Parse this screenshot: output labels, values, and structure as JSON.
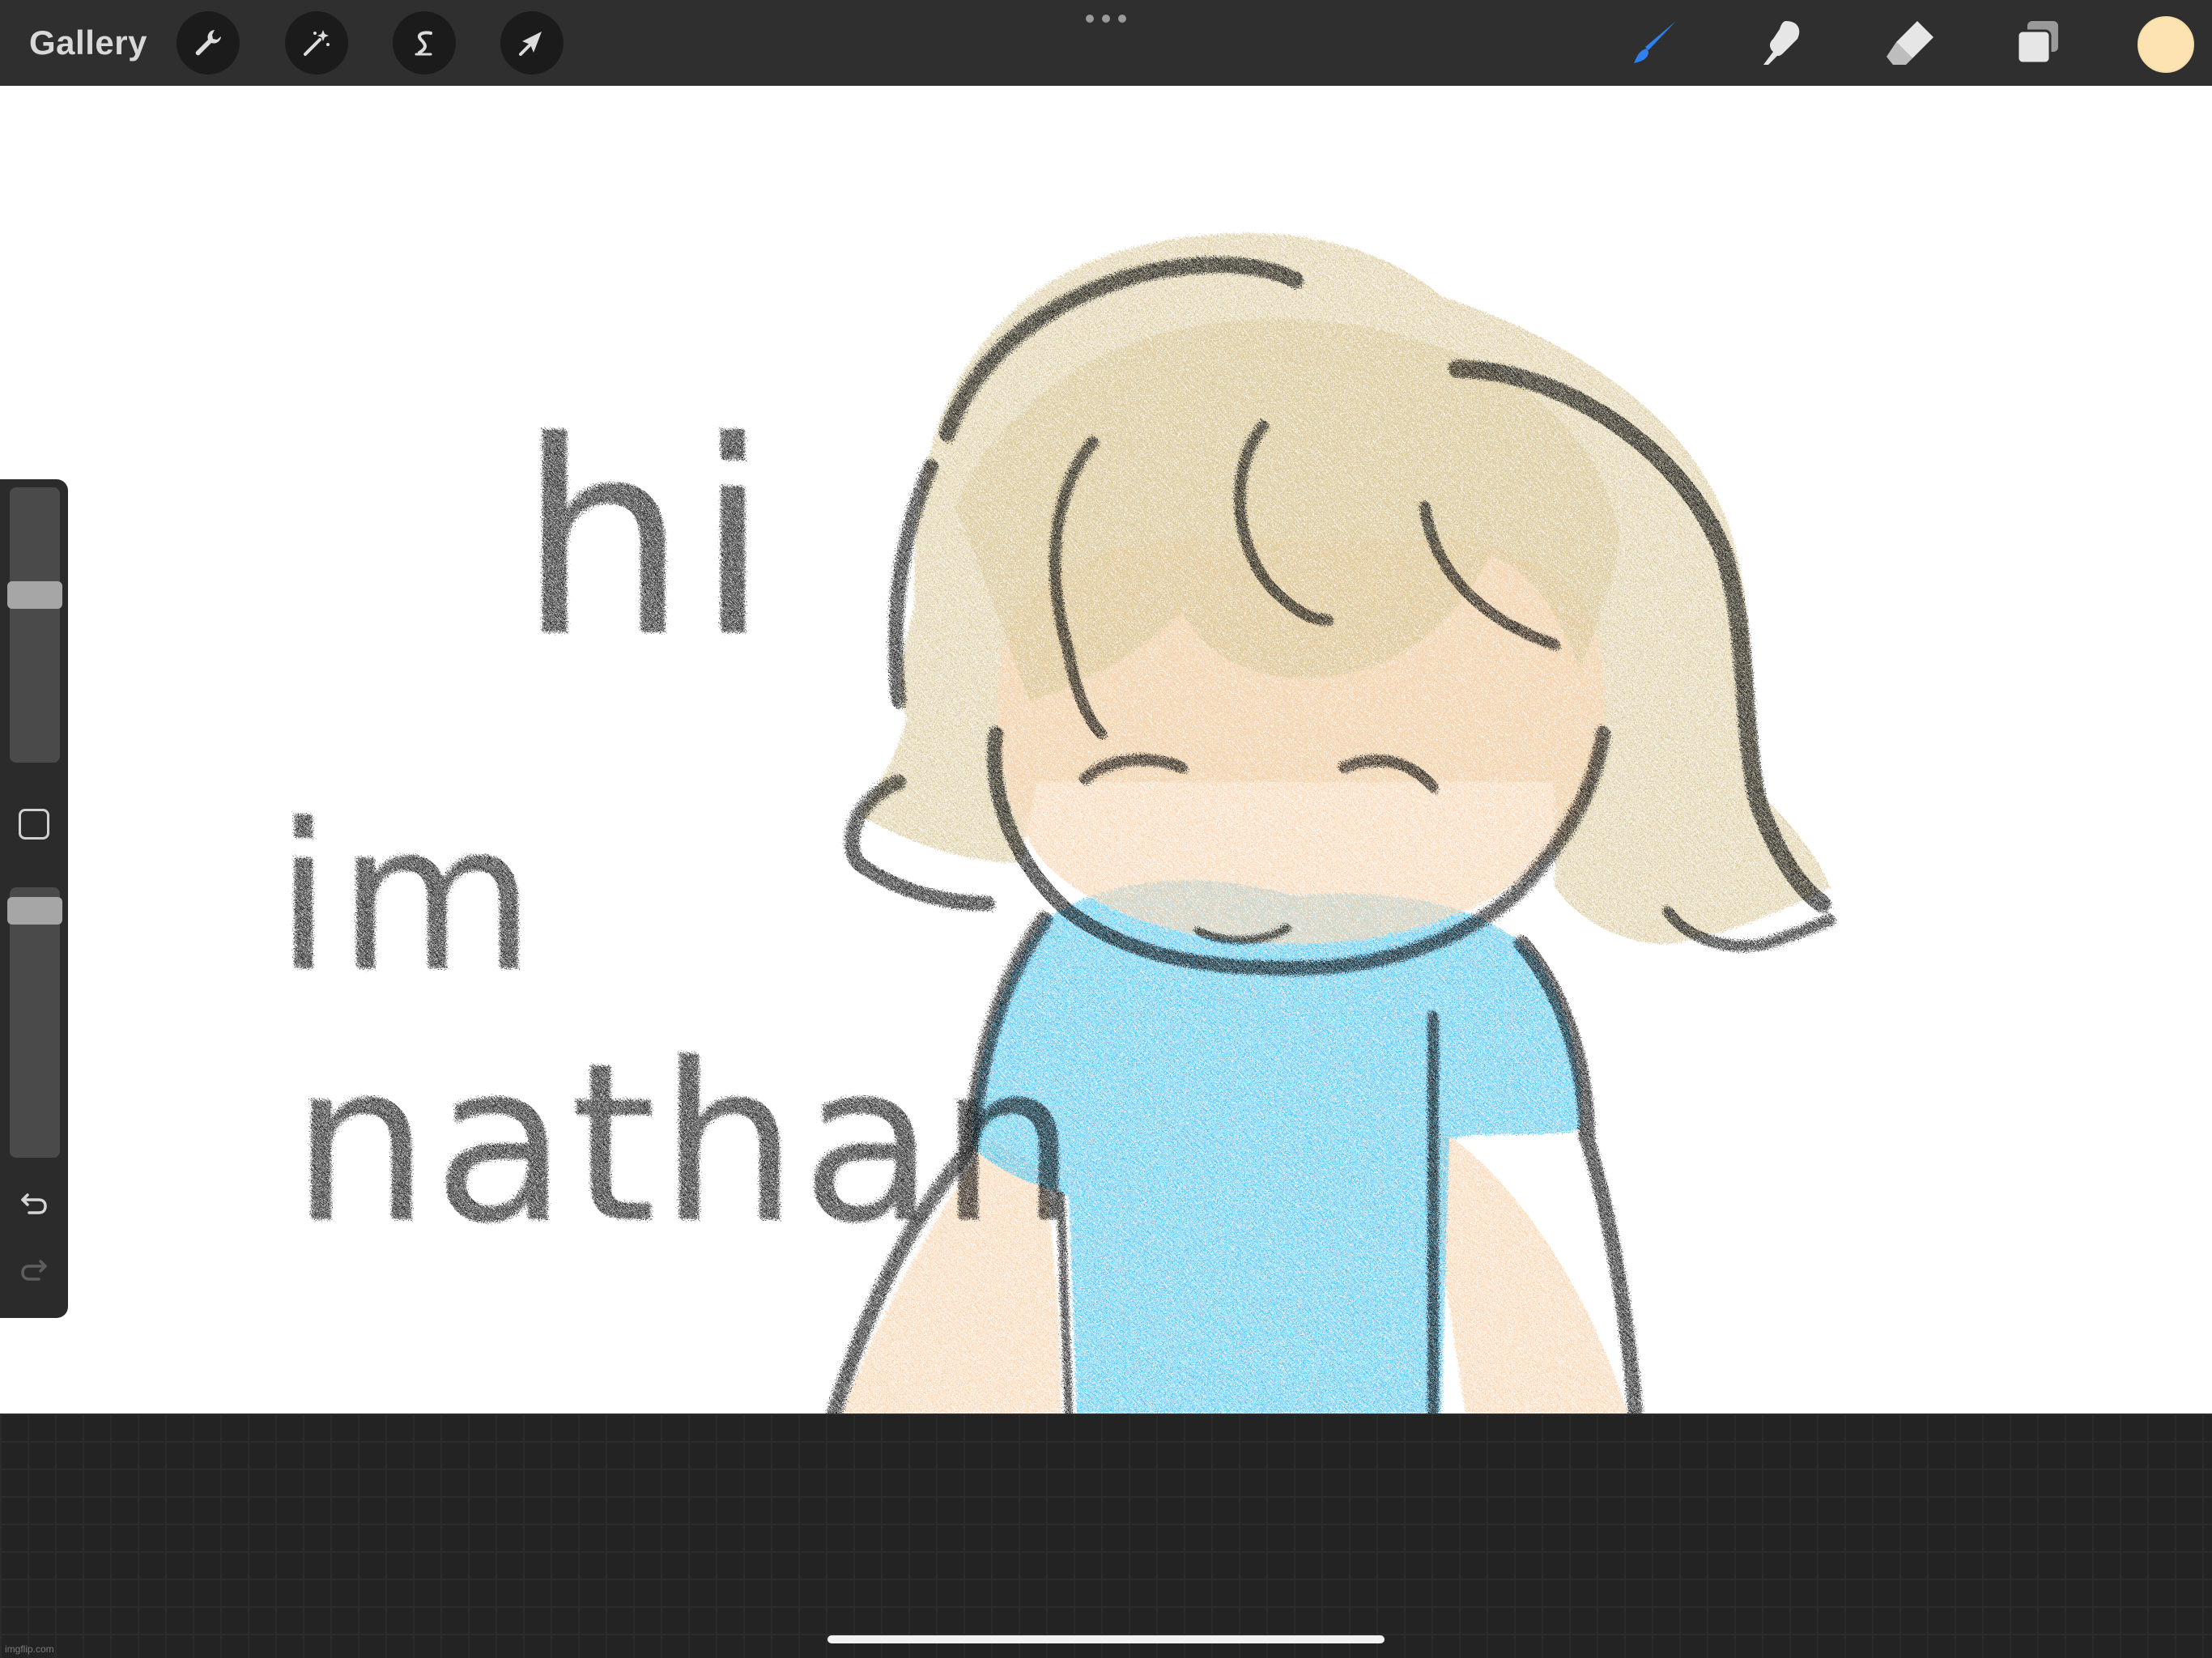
{
  "toolbar": {
    "gallery_label": "Gallery",
    "left_tools": [
      "wrench-icon",
      "magic-wand-icon",
      "selection-s-icon",
      "transform-arrow-icon"
    ],
    "right_tools": [
      "brush-icon",
      "smudge-icon",
      "eraser-icon",
      "layers-icon"
    ],
    "active_tool": "brush",
    "active_tool_color": "#2f7ff0",
    "current_color": "#fde3b1"
  },
  "sidebar": {
    "brush_size_level": 0.62,
    "brush_opacity_level": 0.96,
    "buttons": [
      "modifier-square-icon",
      "undo-icon",
      "redo-icon"
    ]
  },
  "canvas": {
    "text_line_1": "hi",
    "text_line_2": "im",
    "text_line_3": "nathan",
    "colors": {
      "hair": "#d8c594",
      "skin": "#f8cfa6",
      "shirt": "#3fc0f5",
      "outline": "#111111"
    }
  },
  "watermark": "imgflip.com"
}
